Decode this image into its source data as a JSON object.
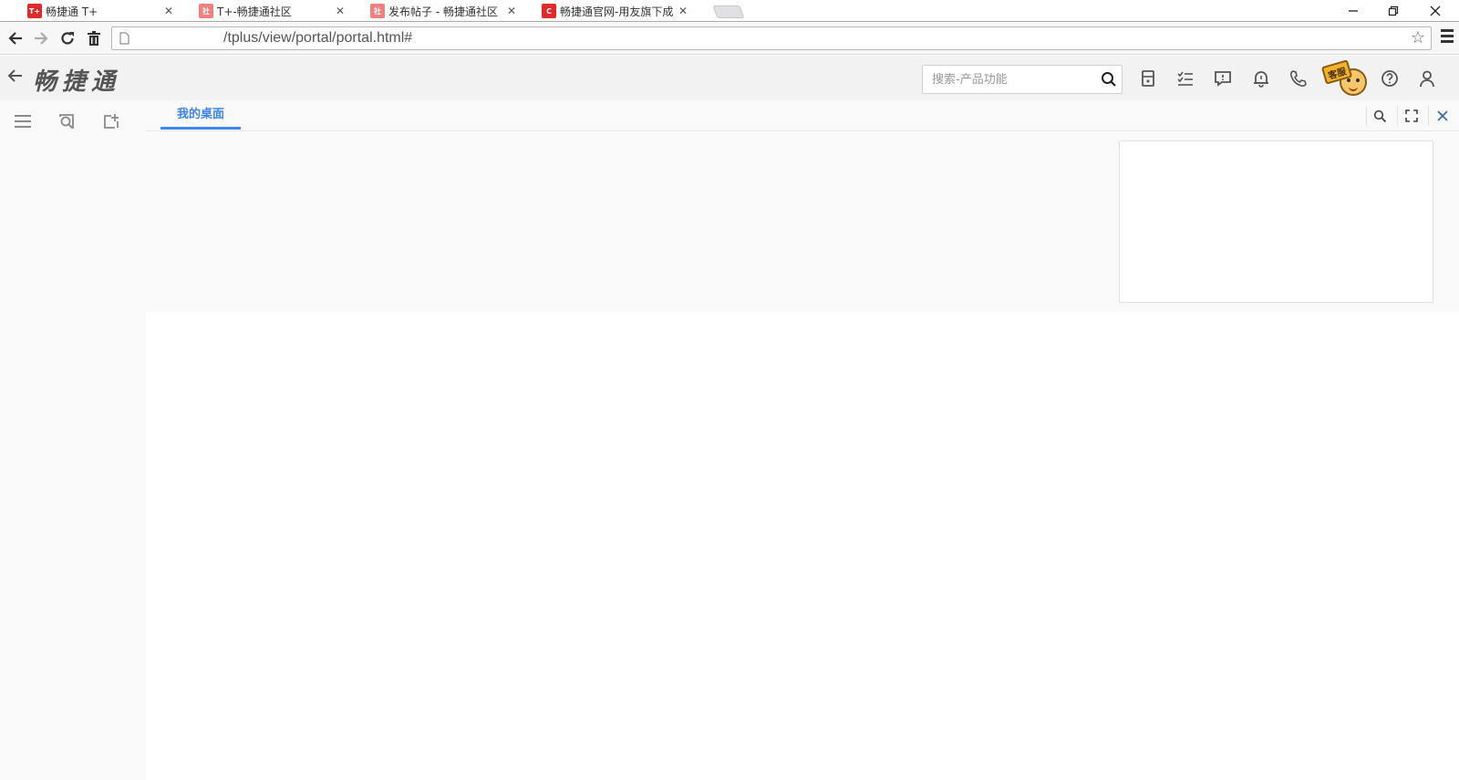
{
  "browser": {
    "tabs": [
      {
        "title": "畅捷通 T+",
        "favicon": "tplus-icon",
        "active": true
      },
      {
        "title": "T+-畅捷通社区",
        "favicon": "community-icon",
        "active": false
      },
      {
        "title": "发布帖子 - 畅捷通社区",
        "favicon": "community-icon",
        "active": false
      },
      {
        "title": "畅捷通官网-用友旗下成员",
        "favicon": "chanjet-icon",
        "active": false
      }
    ],
    "url": "/tplus/view/portal/portal.html#"
  },
  "app": {
    "brand": "畅捷通",
    "search_placeholder": "搜索-产品功能",
    "kefu_label": "客服",
    "active_tab": "我的桌面"
  },
  "colors": {
    "accent": "#3d84f5",
    "icon": "#555555",
    "header_bg": "#f2f2f2",
    "sidebar_bg": "#f9f9f9"
  }
}
